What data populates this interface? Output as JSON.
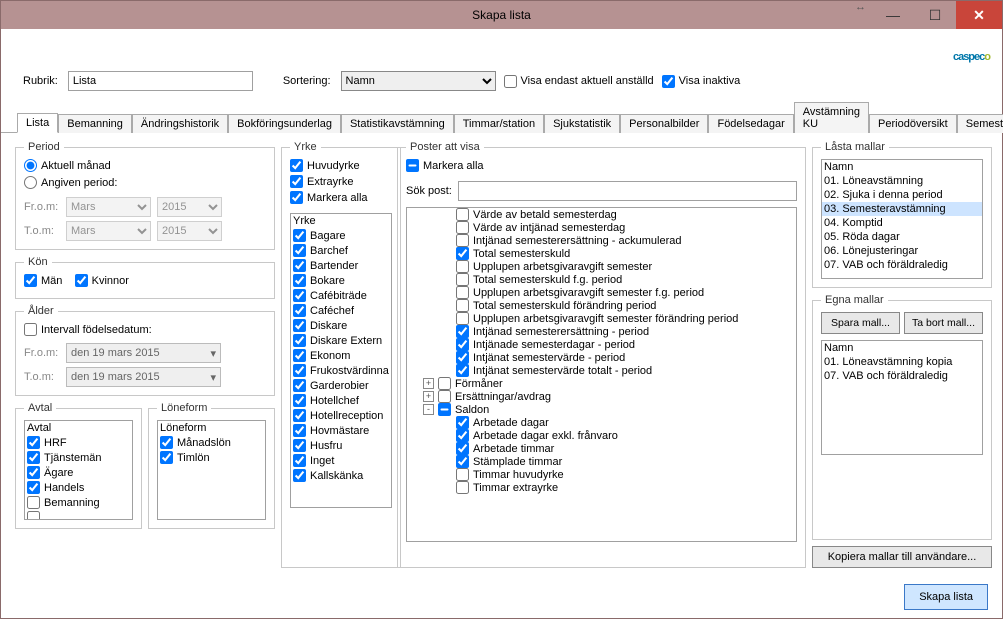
{
  "window": {
    "title": "Skapa lista"
  },
  "logo": {
    "main": "caspec",
    "accent": "o"
  },
  "header": {
    "rubrik_label": "Rubrik:",
    "rubrik_value": "Lista",
    "sortering_label": "Sortering:",
    "sortering_value": "Namn",
    "visa_aktuell": "Visa endast aktuell anställd",
    "visa_inaktiva": "Visa inaktiva"
  },
  "tabs": [
    "Lista",
    "Bemanning",
    "Ändringshistorik",
    "Bokföringsunderlag",
    "Statistikavstämning",
    "Timmar/station",
    "Sjukstatistik",
    "Personalbilder",
    "Födelsedagar",
    "Avstämning KU",
    "Periodöversikt",
    "Semesteravstämning"
  ],
  "period": {
    "legend": "Period",
    "aktuell": "Aktuell månad",
    "angiven": "Angiven period:",
    "from": "Fr.o.m:",
    "tom": "T.o.m:",
    "month": "Mars",
    "year": "2015"
  },
  "kon": {
    "legend": "Kön",
    "man": "Män",
    "kvinnor": "Kvinnor"
  },
  "alder": {
    "legend": "Ålder",
    "intervall": "Intervall födelsedatum:",
    "from": "Fr.o.m:",
    "tom": "T.o.m:",
    "date": "den 19    mars    2015"
  },
  "avtal": {
    "legend": "Avtal",
    "header": "Avtal",
    "items": [
      {
        "label": "HRF",
        "checked": true
      },
      {
        "label": "Tjänstemän",
        "checked": true
      },
      {
        "label": "Ägare",
        "checked": true
      },
      {
        "label": "Handels",
        "checked": true
      },
      {
        "label": "Bemanning",
        "checked": false
      },
      {
        "label": "",
        "checked": false
      }
    ]
  },
  "loneform": {
    "legend": "Löneform",
    "header": "Löneform",
    "items": [
      {
        "label": "Månadslön",
        "checked": true
      },
      {
        "label": "Timlön",
        "checked": true
      }
    ]
  },
  "yrke": {
    "legend": "Yrke",
    "huvud": "Huvudyrke",
    "extra": "Extrayrke",
    "markera": "Markera alla",
    "header": "Yrke",
    "items": [
      "Bagare",
      "Barchef",
      "Bartender",
      "Bokare",
      "Cafébiträde",
      "Caféchef",
      "Diskare",
      "Diskare Extern",
      "Ekonom",
      "Frukostvärdinna",
      "Garderobier",
      "Hotellchef",
      "Hotellreception",
      "Hovmästare",
      "Husfru",
      "Inget",
      "Kallskänka"
    ]
  },
  "poster": {
    "legend": "Poster att visa",
    "markera": "Markera alla",
    "sok_label": "Sök post:",
    "rows": [
      {
        "indent": 1,
        "exp": null,
        "checked": false,
        "label": "Värde av betald semesterdag"
      },
      {
        "indent": 1,
        "exp": null,
        "checked": false,
        "label": "Värde av intjänad semesterdag"
      },
      {
        "indent": 1,
        "exp": null,
        "checked": false,
        "label": "Intjänad semesterersättning - ackumulerad"
      },
      {
        "indent": 1,
        "exp": null,
        "checked": true,
        "label": "Total semesterskuld"
      },
      {
        "indent": 1,
        "exp": null,
        "checked": false,
        "label": "Upplupen arbetsgivaravgift semester"
      },
      {
        "indent": 1,
        "exp": null,
        "checked": false,
        "label": "Total semesterskuld f.g. period"
      },
      {
        "indent": 1,
        "exp": null,
        "checked": false,
        "label": "Upplupen arbetsgivaravgift semester f.g. period"
      },
      {
        "indent": 1,
        "exp": null,
        "checked": false,
        "label": "Total semesterskuld förändring period"
      },
      {
        "indent": 1,
        "exp": null,
        "checked": false,
        "label": "Upplupen arbetsgivaravgift semester förändring period"
      },
      {
        "indent": 1,
        "exp": null,
        "checked": true,
        "label": "Intjänad semesterersättning - period"
      },
      {
        "indent": 1,
        "exp": null,
        "checked": true,
        "label": "Intjänade semesterdagar - period"
      },
      {
        "indent": 1,
        "exp": null,
        "checked": true,
        "label": "Intjänat semestervärde - period"
      },
      {
        "indent": 1,
        "exp": null,
        "checked": true,
        "label": "Intjänat semestervärde totalt - period"
      },
      {
        "indent": 0,
        "exp": "+",
        "checked": false,
        "label": "Förmåner"
      },
      {
        "indent": 0,
        "exp": "+",
        "checked": false,
        "label": "Ersättningar/avdrag"
      },
      {
        "indent": 0,
        "exp": "-",
        "checked": "mixed",
        "label": "Saldon"
      },
      {
        "indent": 1,
        "exp": null,
        "checked": true,
        "label": "Arbetade dagar"
      },
      {
        "indent": 1,
        "exp": null,
        "checked": true,
        "label": "Arbetade dagar exkl. frånvaro"
      },
      {
        "indent": 1,
        "exp": null,
        "checked": true,
        "label": "Arbetade timmar"
      },
      {
        "indent": 1,
        "exp": null,
        "checked": true,
        "label": "Stämplade timmar"
      },
      {
        "indent": 1,
        "exp": null,
        "checked": false,
        "label": "Timmar huvudyrke"
      },
      {
        "indent": 1,
        "exp": null,
        "checked": false,
        "label": "Timmar extrayrke"
      }
    ]
  },
  "locked": {
    "legend": "Låsta mallar",
    "header": "Namn",
    "items": [
      "01. Löneavstämning",
      "02. Sjuka i denna period",
      "03. Semesteravstämning",
      "04. Komptid",
      "05. Röda dagar",
      "06. Lönejusteringar",
      "07. VAB och föräldraledig"
    ],
    "selected_index": 2
  },
  "own": {
    "legend": "Egna mallar",
    "spara": "Spara mall...",
    "tabort": "Ta bort mall...",
    "header": "Namn",
    "items": [
      "01. Löneavstämning kopia",
      "07. VAB och föräldraledig"
    ]
  },
  "kopiera_button": "Kopiera mallar till användare...",
  "skapa_button": "Skapa lista"
}
